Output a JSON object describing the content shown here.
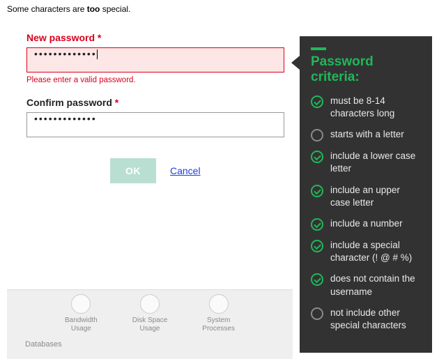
{
  "note": {
    "pre": "Some characters are ",
    "bold": "too",
    "post": " special."
  },
  "form": {
    "new_pw_label": "New password",
    "new_pw_value": "•••••••••••••",
    "new_pw_error": "Please enter a valid password.",
    "confirm_label": "Confirm password",
    "confirm_value": "•••••••••••••",
    "required_mark": "*",
    "ok_label": "OK",
    "cancel_label": "Cancel"
  },
  "tooltip": {
    "title": "Password criteria:",
    "criteria": [
      {
        "pass": true,
        "text": "must be 8-14 characters long"
      },
      {
        "pass": false,
        "text": "starts with a letter"
      },
      {
        "pass": true,
        "text": "include a lower case letter"
      },
      {
        "pass": true,
        "text": "include an upper case letter"
      },
      {
        "pass": true,
        "text": "include a number"
      },
      {
        "pass": true,
        "text": "include a special character (! @ # %)"
      },
      {
        "pass": true,
        "text": "does not contain the username"
      },
      {
        "pass": false,
        "text": "not include other special characters"
      }
    ]
  },
  "bottom": {
    "items": [
      {
        "label1": "Bandwidth",
        "label2": "Usage"
      },
      {
        "label1": "Disk Space",
        "label2": "Usage"
      },
      {
        "label1": "System",
        "label2": "Processes"
      }
    ],
    "category": "Databases"
  }
}
